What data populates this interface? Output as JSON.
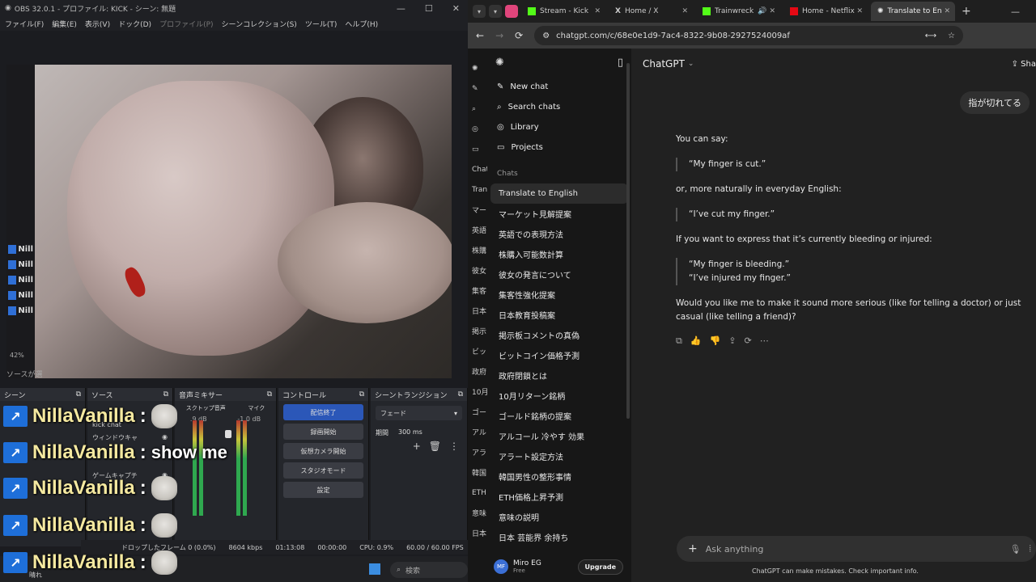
{
  "obs": {
    "title": "OBS 32.0.1 - プロファイル: KICK - シーン: 無題",
    "menu": [
      "ファイル(F)",
      "編集(E)",
      "表示(V)",
      "ドック(D)",
      "プロファイル(P)",
      "シーンコレクション(S)",
      "ツール(T)",
      "ヘルプ(H)"
    ],
    "zoom": "42%",
    "sources_label": "ソースが選",
    "docks": {
      "scenes": "シーン",
      "sources": "ソース",
      "mixer": "音声ミキサー",
      "controls": "コントロール",
      "transitions": "シーントランジション"
    },
    "source_rows": [
      "kick chat",
      "ウィンドウキャ",
      "ゲームキャプチ"
    ],
    "mixer": {
      "desktop": "スクトップ音声",
      "mic": "マイク",
      "desktop_db": ".9 dB",
      "mic_db": "-1.0 dB"
    },
    "controls": {
      "stop_stream": "配信終了",
      "start_record": "録画開始",
      "virtual_cam": "仮想カメラ開始",
      "studio_mode": "スタジオモード",
      "settings": "設定"
    },
    "transition": {
      "type": "フェード",
      "duration_label": "期間",
      "duration": "300 ms"
    },
    "status": {
      "dropped": "ドロップしたフレーム 0 (0.0%)",
      "bitrate": "8604 kbps",
      "stream_time": "01:13:08",
      "record_time": "00:00:00",
      "cpu": "CPU: 0.9%",
      "fps": "60.00 / 60.00 FPS"
    },
    "taskbar_search": "検索",
    "weather": "晴れ"
  },
  "chat_overlay": {
    "user": "NillaVanilla",
    "colon": ":",
    "lines": [
      "",
      "show me",
      "",
      "",
      ""
    ]
  },
  "mini_list": [
    "Nill",
    "Nill",
    "Nill",
    "Nill",
    "Nill"
  ],
  "browser": {
    "tabs": [
      {
        "label": "Stream - Kick",
        "color": "#53fc18"
      },
      {
        "label": "Home / X",
        "color": "#ffffff"
      },
      {
        "label": "Trainwreck",
        "color": "#53fc18"
      },
      {
        "label": "Home - Netflix",
        "color": "#e50914"
      },
      {
        "label": "Translate to En",
        "color": "#cccccc"
      }
    ],
    "url": "chatgpt.com/c/68e0e1d9-7ac4-8322-9b08-2927524009af"
  },
  "chatgpt": {
    "header_title": "ChatGPT",
    "share": "Sha",
    "rail_items": [
      "Chats",
      "Tran",
      "マー",
      "英語",
      "株購",
      "彼女",
      "集客",
      "日本",
      "掲示",
      "ビッ",
      "政府",
      "10月",
      "ゴー",
      "アル",
      "アラ",
      "韓国",
      "ETH",
      "意味",
      "日本"
    ],
    "nav": {
      "new_chat": "New chat",
      "search": "Search chats",
      "library": "Library",
      "projects": "Projects"
    },
    "chats_heading": "Chats",
    "chats": [
      "Translate to English",
      "マーケット見解提案",
      "英語での表現方法",
      "株購入可能数計算",
      "彼女の発言について",
      "集客性強化提案",
      "日本教育投稿案",
      "掲示板コメントの真偽",
      "ビットコイン価格予測",
      "政府閉鎖とは",
      "10月リターン銘柄",
      "ゴールド銘柄の提案",
      "アルコール 冷やす 効果",
      "アラート設定方法",
      "韓国男性の整形事情",
      "ETH価格上昇予測",
      "意味の説明",
      "日本 芸能界 余持ち"
    ],
    "user": {
      "initials": "MF",
      "name": "Miro EG",
      "plan": "Free",
      "upgrade": "Upgrade"
    },
    "user_message": "指が切れてる",
    "answer": {
      "intro": "You can say:",
      "quote1": "“My finger is cut.”",
      "alt": "or, more naturally in everyday English:",
      "quote2": "“I’ve cut my finger.”",
      "bleeding": "If you want to express that it’s currently bleeding or injured:",
      "quote3a": "“My finger is bleeding.”",
      "quote3b": "“I’ve injured my finger.”",
      "closing": "Would you like me to make it sound more serious (like for telling a doctor) or just casual (like telling a friend)?"
    },
    "composer_placeholder": "Ask anything",
    "disclaimer": "ChatGPT can make mistakes. Check important info."
  }
}
